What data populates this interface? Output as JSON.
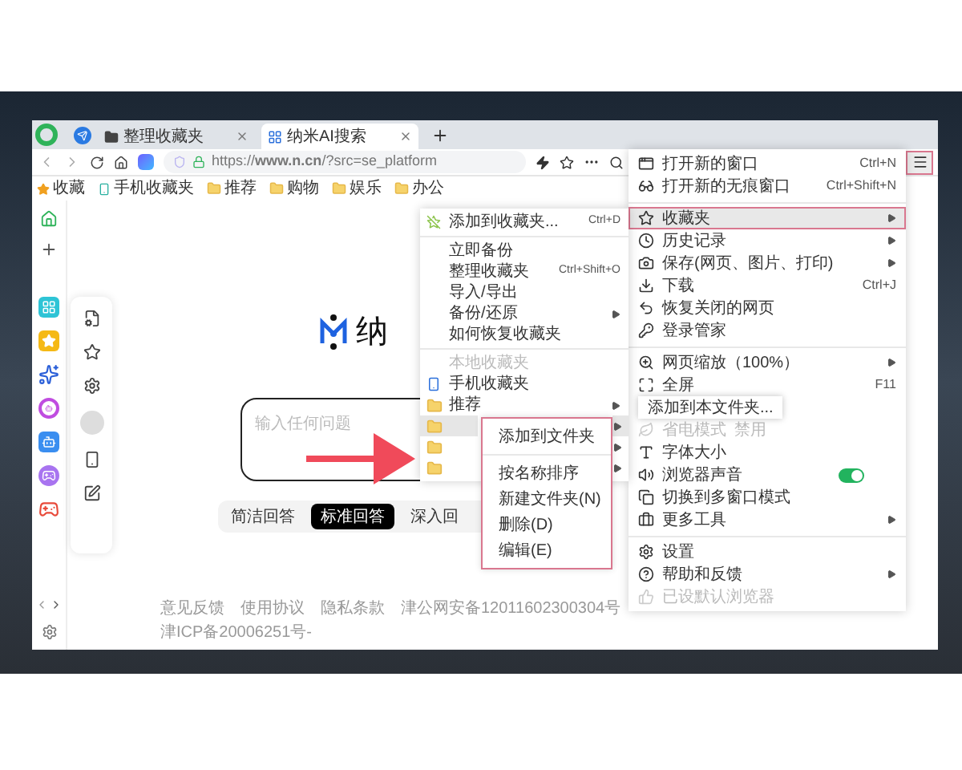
{
  "tabs": [
    {
      "label": "整理收藏夹",
      "selected": false
    },
    {
      "label": "纳米AI搜索",
      "selected": true
    }
  ],
  "address_bar": {
    "url": "https://**www.n.cn**/?src=se_platform"
  },
  "bookmarks": [
    {
      "kind": "menu",
      "label": "收藏"
    },
    {
      "kind": "phone",
      "label": "手机收藏夹"
    },
    {
      "kind": "folder",
      "label": "推荐"
    },
    {
      "kind": "folder",
      "label": "购物"
    },
    {
      "kind": "folder",
      "label": "娱乐"
    },
    {
      "kind": "folder",
      "label": "办公"
    }
  ],
  "page": {
    "logo_text": "纳",
    "search_placeholder": "输入任何问题",
    "modes": [
      {
        "label": "简洁回答",
        "selected": false
      },
      {
        "label": "标准回答",
        "selected": true
      },
      {
        "label": "深入回",
        "selected": false
      }
    ],
    "footer": [
      "意见反馈",
      "使用协议",
      "隐私条款",
      "津公网安备12011602300304号",
      "津ICP备20006251号-"
    ]
  },
  "main_menu": {
    "items": [
      {
        "kind": "item",
        "label": "打开新的窗口",
        "shortcut": "Ctrl+N",
        "submenu": false,
        "selected": false,
        "disabled": false
      },
      {
        "kind": "item",
        "label": "打开新的无痕窗口",
        "shortcut": "Ctrl+Shift+N",
        "submenu": false,
        "selected": false,
        "disabled": false
      },
      {
        "kind": "separator"
      },
      {
        "kind": "item",
        "label": "收藏夹",
        "submenu": true,
        "selected": true,
        "disabled": false
      },
      {
        "kind": "item",
        "label": "历史记录",
        "submenu": true,
        "selected": false,
        "disabled": false
      },
      {
        "kind": "item",
        "label": "保存(网页、图片、打印)",
        "submenu": true,
        "selected": false,
        "disabled": false
      },
      {
        "kind": "item",
        "label": "下载",
        "shortcut": "Ctrl+J",
        "submenu": false,
        "selected": false,
        "disabled": false
      },
      {
        "kind": "item",
        "label": "恢复关闭的网页",
        "submenu": false,
        "selected": false,
        "disabled": false
      },
      {
        "kind": "item",
        "label": "登录管家",
        "submenu": false,
        "selected": false,
        "disabled": false
      },
      {
        "kind": "separator"
      },
      {
        "kind": "item",
        "label": "网页缩放（100%）",
        "submenu": true,
        "selected": false,
        "disabled": false
      },
      {
        "kind": "item",
        "label": "全屏",
        "shortcut": "F11",
        "submenu": false,
        "selected": false,
        "disabled": false
      },
      {
        "kind": "covered"
      },
      {
        "kind": "item",
        "label": "省电模式",
        "note": "禁用",
        "submenu": false,
        "selected": false,
        "disabled": true
      },
      {
        "kind": "item",
        "label": "字体大小",
        "submenu": false,
        "selected": false,
        "disabled": false
      },
      {
        "kind": "toggle",
        "label": "浏览器声音",
        "on": true,
        "selected": false,
        "disabled": false
      },
      {
        "kind": "item",
        "label": "切换到多窗口模式",
        "submenu": false,
        "selected": false,
        "disabled": false
      },
      {
        "kind": "item",
        "label": "更多工具",
        "submenu": true,
        "selected": false,
        "disabled": false
      },
      {
        "kind": "separator"
      },
      {
        "kind": "item",
        "label": "设置",
        "submenu": false,
        "selected": false,
        "disabled": false
      },
      {
        "kind": "item",
        "label": "帮助和反馈",
        "submenu": true,
        "selected": false,
        "disabled": false
      },
      {
        "kind": "item",
        "label": "已设默认浏览器",
        "submenu": false,
        "selected": false,
        "disabled": true
      }
    ]
  },
  "favorites_menu": {
    "items": [
      {
        "kind": "item",
        "label": "添加到收藏夹...",
        "shortcut": "Ctrl+D",
        "submenu": false,
        "selected": false
      },
      {
        "kind": "separator"
      },
      {
        "kind": "item",
        "label": "立即备份",
        "submenu": false,
        "selected": false
      },
      {
        "kind": "item",
        "label": "整理收藏夹",
        "shortcut": "Ctrl+Shift+O",
        "submenu": false,
        "selected": false
      },
      {
        "kind": "item",
        "label": "导入/导出",
        "submenu": false,
        "selected": false
      },
      {
        "kind": "item",
        "label": "备份/还原",
        "submenu": true,
        "selected": false
      },
      {
        "kind": "item",
        "label": "如何恢复收藏夹",
        "submenu": false,
        "selected": false
      },
      {
        "kind": "separator"
      },
      {
        "kind": "header",
        "label": "本地收藏夹"
      },
      {
        "kind": "phone",
        "label": "手机收藏夹",
        "submenu": false,
        "selected": false
      },
      {
        "kind": "folder",
        "label": "推荐",
        "submenu": true,
        "selected": false
      },
      {
        "kind": "folder",
        "submenu": true,
        "selected": true
      },
      {
        "kind": "folder",
        "submenu": true,
        "selected": false
      },
      {
        "kind": "folder",
        "submenu": true,
        "selected": false
      }
    ]
  },
  "context_menu": {
    "items": [
      {
        "kind": "item",
        "label": "添加到文件夹"
      },
      {
        "kind": "separator"
      },
      {
        "kind": "item",
        "label": "按名称排序"
      },
      {
        "kind": "item",
        "label": "新建文件夹(N)"
      },
      {
        "kind": "item",
        "label": "删除(D)"
      },
      {
        "kind": "item",
        "label": "编辑(E)"
      }
    ]
  },
  "tooltip": "添加到本文件夹..."
}
